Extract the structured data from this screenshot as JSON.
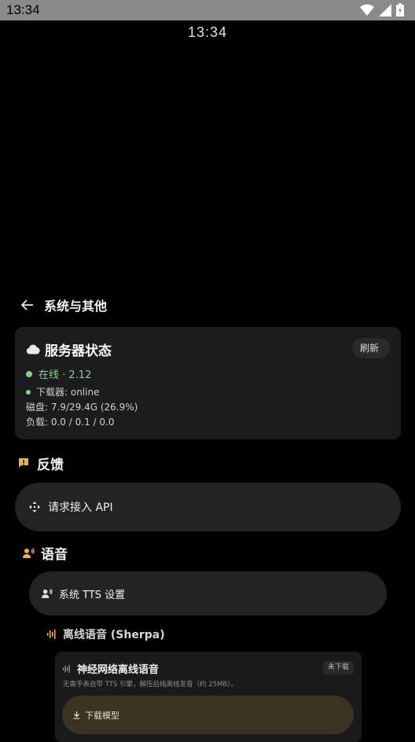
{
  "status_bar": {
    "time": "13:34"
  },
  "lock_clock": "13:34",
  "header": {
    "title": "系统与其他"
  },
  "server": {
    "title": "服务器状态",
    "refresh_label": "刷新",
    "online_text": "在线 · 2.12",
    "downloader_text": "下载器: online",
    "disk_text": "磁盘: 7.9/29.4G (26.9%)",
    "load_text": "负载: 0.0 / 0.1 / 0.0"
  },
  "feedback": {
    "title": "反馈",
    "api_request_label": "请求接入 API"
  },
  "voice": {
    "title": "语音",
    "tts_settings_label": "系统 TTS 设置",
    "offline_title": "离线语音 (Sherpa)",
    "neural": {
      "title": "神经网络离线语音",
      "badge": "未下载",
      "description": "无需手表自带 TTS 引擎，解压后纯离线发音（约 25MB）。",
      "download_label": "下载模型"
    }
  },
  "colors": {
    "online_green": "#8fc98f",
    "accent_amber": "#e8b35a",
    "card_bg": "#1c1c1e"
  }
}
